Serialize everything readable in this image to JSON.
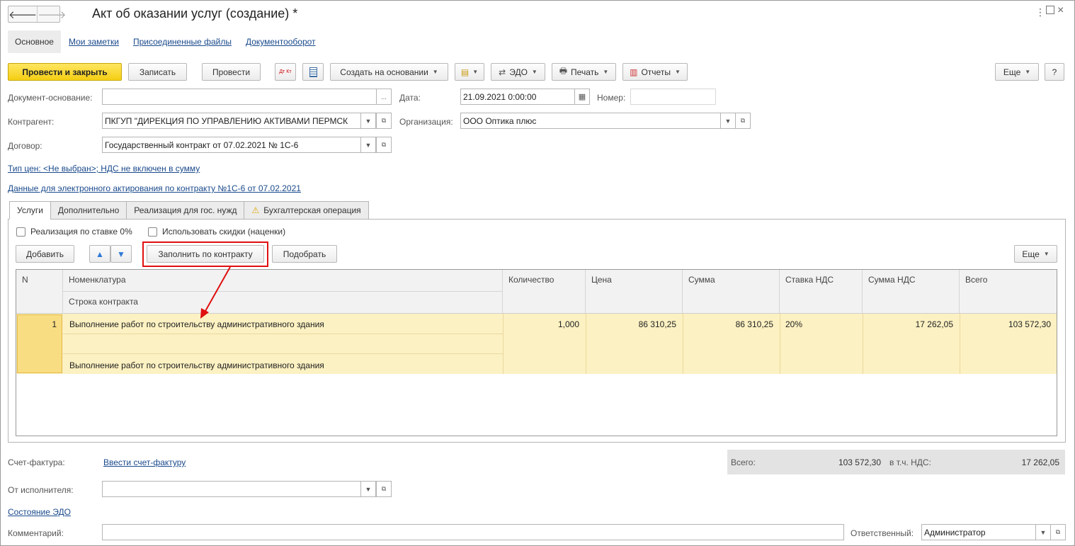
{
  "window": {
    "title": "Акт об оказании услуг (создание) *",
    "nav_back": "🡐",
    "nav_fwd": "🡒",
    "icons": [
      "more-vert-icon",
      "maximize-icon",
      "close-icon"
    ]
  },
  "topnav": {
    "main": "Основное",
    "notes": "Мои заметки",
    "files": "Присоединенные файлы",
    "docflow": "Документооборот"
  },
  "toolbar": {
    "post_close": "Провести и закрыть",
    "save": "Записать",
    "post": "Провести",
    "dt_kt": "Дт Кт",
    "create_based": "Создать на основании",
    "edo": "ЭДО",
    "print": "Печать",
    "reports": "Отчеты",
    "more": "Еще",
    "help": "?"
  },
  "form": {
    "basis_label": "Документ-основание:",
    "basis_value": "",
    "basis_btn": "...",
    "date_label": "Дата:",
    "date_value": "21.09.2021  0:00:00",
    "number_label": "Номер:",
    "number_value": "",
    "counterparty_label": "Контрагент:",
    "counterparty_value": "ПКГУП \"ДИРЕКЦИЯ ПО УПРАВЛЕНИЮ АКТИВАМИ ПЕРМСК",
    "org_label": "Организация:",
    "org_value": "ООО Оптика плюс",
    "contract_label": "Договор:",
    "contract_value": "Государственный контракт от 07.02.2021 № 1С-6",
    "price_type_link": "Тип цен: <Не выбран>; НДС не включен в сумму",
    "e_act_link": "Данные для электронного актирования по контракту №1С-6 от 07.02.2021"
  },
  "tabs": {
    "services": "Услуги",
    "additional": "Дополнительно",
    "gov": "Реализация для гос. нужд",
    "accounting": "Бухгалтерская операция"
  },
  "options": {
    "zero_rate": "Реализация по ставке 0%",
    "discounts": "Использовать скидки (наценки)"
  },
  "table_toolbar": {
    "add": "Добавить",
    "fill": "Заполнить по контракту",
    "pick": "Подобрать",
    "more": "Еще"
  },
  "table": {
    "headers": {
      "n": "N",
      "item": "Номенклатура",
      "contract_line": "Строка контракта",
      "qty": "Количество",
      "price": "Цена",
      "sum": "Сумма",
      "vat_rate": "Ставка НДС",
      "vat_sum": "Сумма НДС",
      "total": "Всего"
    },
    "rows": [
      {
        "n": "1",
        "item": "Выполнение работ по строительству административного здания",
        "contract_line": "Выполнение работ по строительству административного здания",
        "qty": "1,000",
        "price": "86 310,25",
        "sum": "86 310,25",
        "vat_rate": "20%",
        "vat_sum": "17 262,05",
        "total": "103 572,30"
      }
    ]
  },
  "footer": {
    "invoice_label": "Счет-фактура:",
    "invoice_link": "Ввести счет-фактуру",
    "total_label": "Всего:",
    "total_value": "103 572,30",
    "vat_label": "в т.ч. НДС:",
    "vat_value": "17 262,05",
    "performer_label": "От исполнителя:",
    "performer_value": "",
    "edo_status_link": "Состояние ЭДО",
    "comment_label": "Комментарий:",
    "comment_value": "",
    "responsible_label": "Ответственный:",
    "responsible_value": "Администратор"
  },
  "colors": {
    "accent_yellow": "#f4cf13",
    "row_highlight": "#fcf1c2",
    "annotation_red": "#e01010",
    "link_blue": "#1a4a8c"
  }
}
